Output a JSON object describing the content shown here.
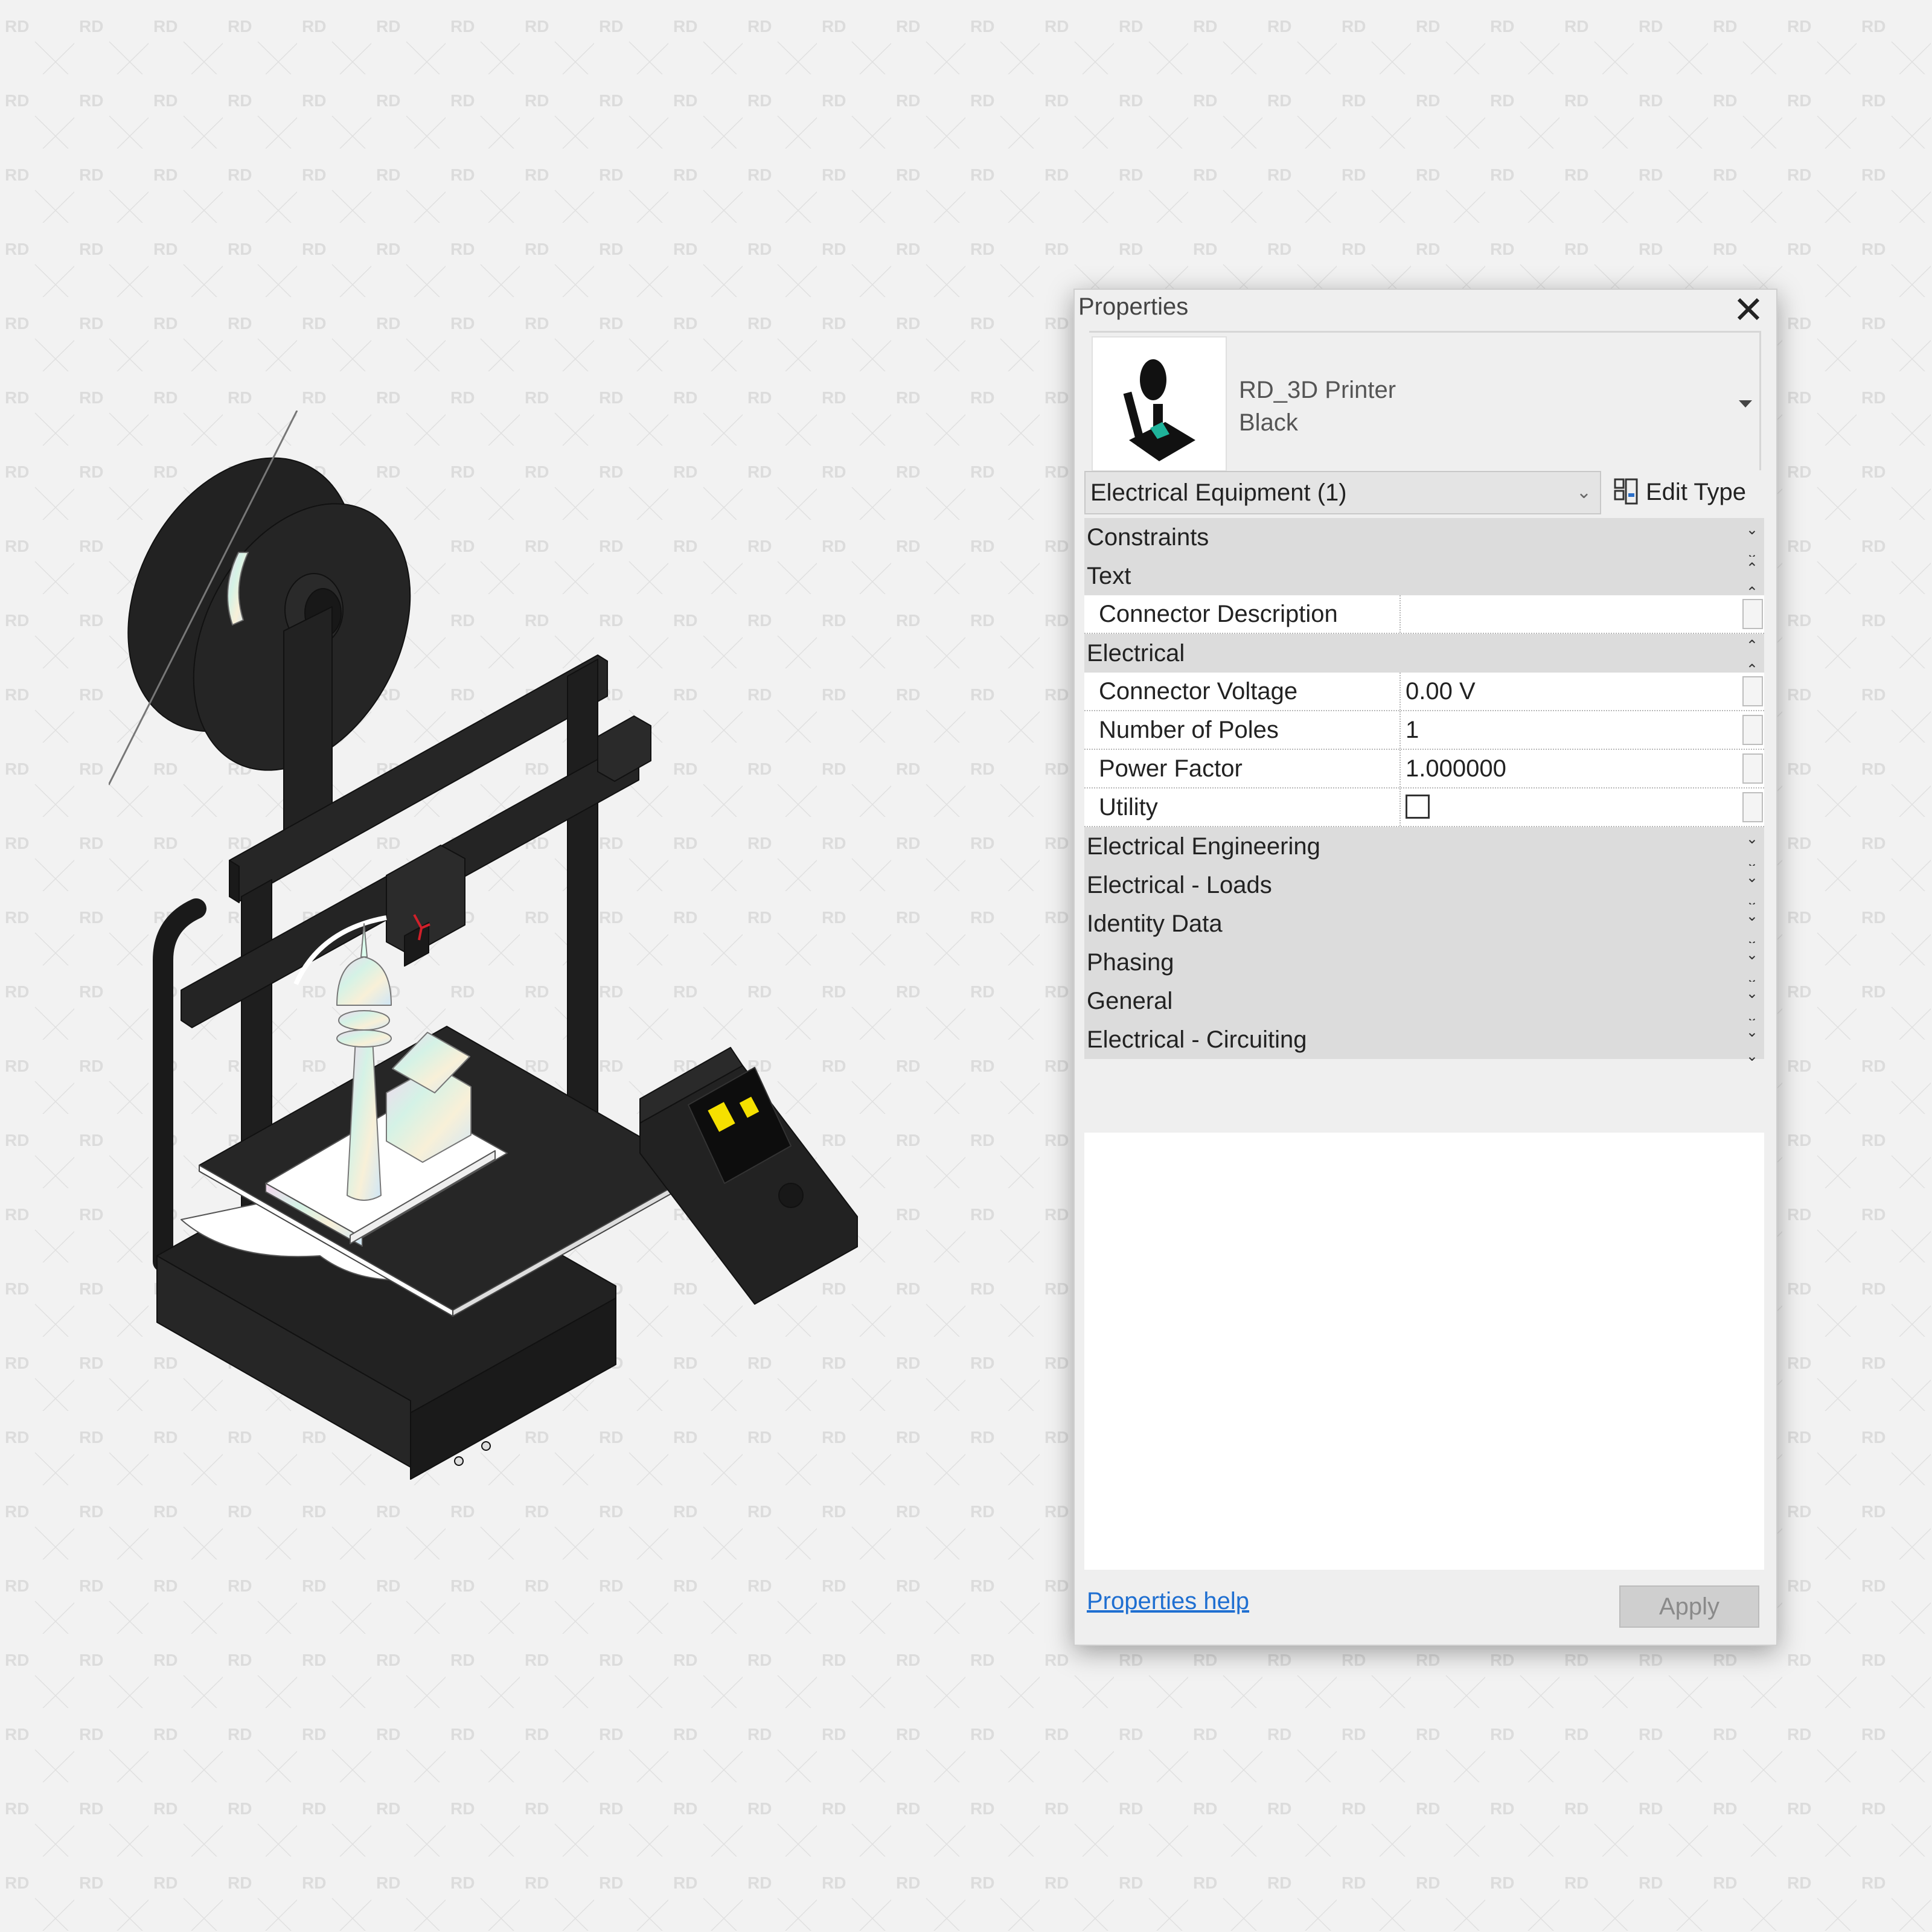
{
  "watermark": {
    "text": "RD",
    "color": "#dadada"
  },
  "properties_panel": {
    "title": "Properties",
    "close_icon": "close-icon",
    "type_selector": {
      "family_name": "RD_3D Printer",
      "type_name": "Black",
      "thumbnail_icon": "3d-printer-thumbnail"
    },
    "instance_filter": {
      "selected": "Electrical Equipment (1)"
    },
    "edit_type_label": "Edit Type",
    "groups": [
      {
        "label": "Constraints",
        "expanded": false,
        "toggle": "»"
      },
      {
        "label": "Text",
        "expanded": true,
        "toggle": "«",
        "rows": [
          {
            "name": "Connector Description",
            "value": ""
          }
        ]
      },
      {
        "label": "Electrical",
        "expanded": true,
        "toggle": "«",
        "rows": [
          {
            "name": "Connector Voltage",
            "value": "0.00 V"
          },
          {
            "name": "Number of Poles",
            "value": "1"
          },
          {
            "name": "Power Factor",
            "value": "1.000000"
          },
          {
            "name": "Utility",
            "value": "",
            "checkbox": true,
            "checked": false
          }
        ]
      },
      {
        "label": "Electrical Engineering",
        "expanded": false,
        "toggle": "»"
      },
      {
        "label": "Electrical - Loads",
        "expanded": false,
        "toggle": "»"
      },
      {
        "label": "Identity Data",
        "expanded": false,
        "toggle": "»"
      },
      {
        "label": "Phasing",
        "expanded": false,
        "toggle": "»"
      },
      {
        "label": "General",
        "expanded": false,
        "toggle": "»"
      },
      {
        "label": "Electrical - Circuiting",
        "expanded": false,
        "toggle": "»"
      }
    ],
    "help_link": "Properties help",
    "apply_label": "Apply",
    "link_color": "#1f6fd1"
  },
  "viewport": {
    "model": "3D printer isometric view",
    "screen_highlight_color": "#f5e000",
    "hotend_accent_color": "#d0202a"
  }
}
